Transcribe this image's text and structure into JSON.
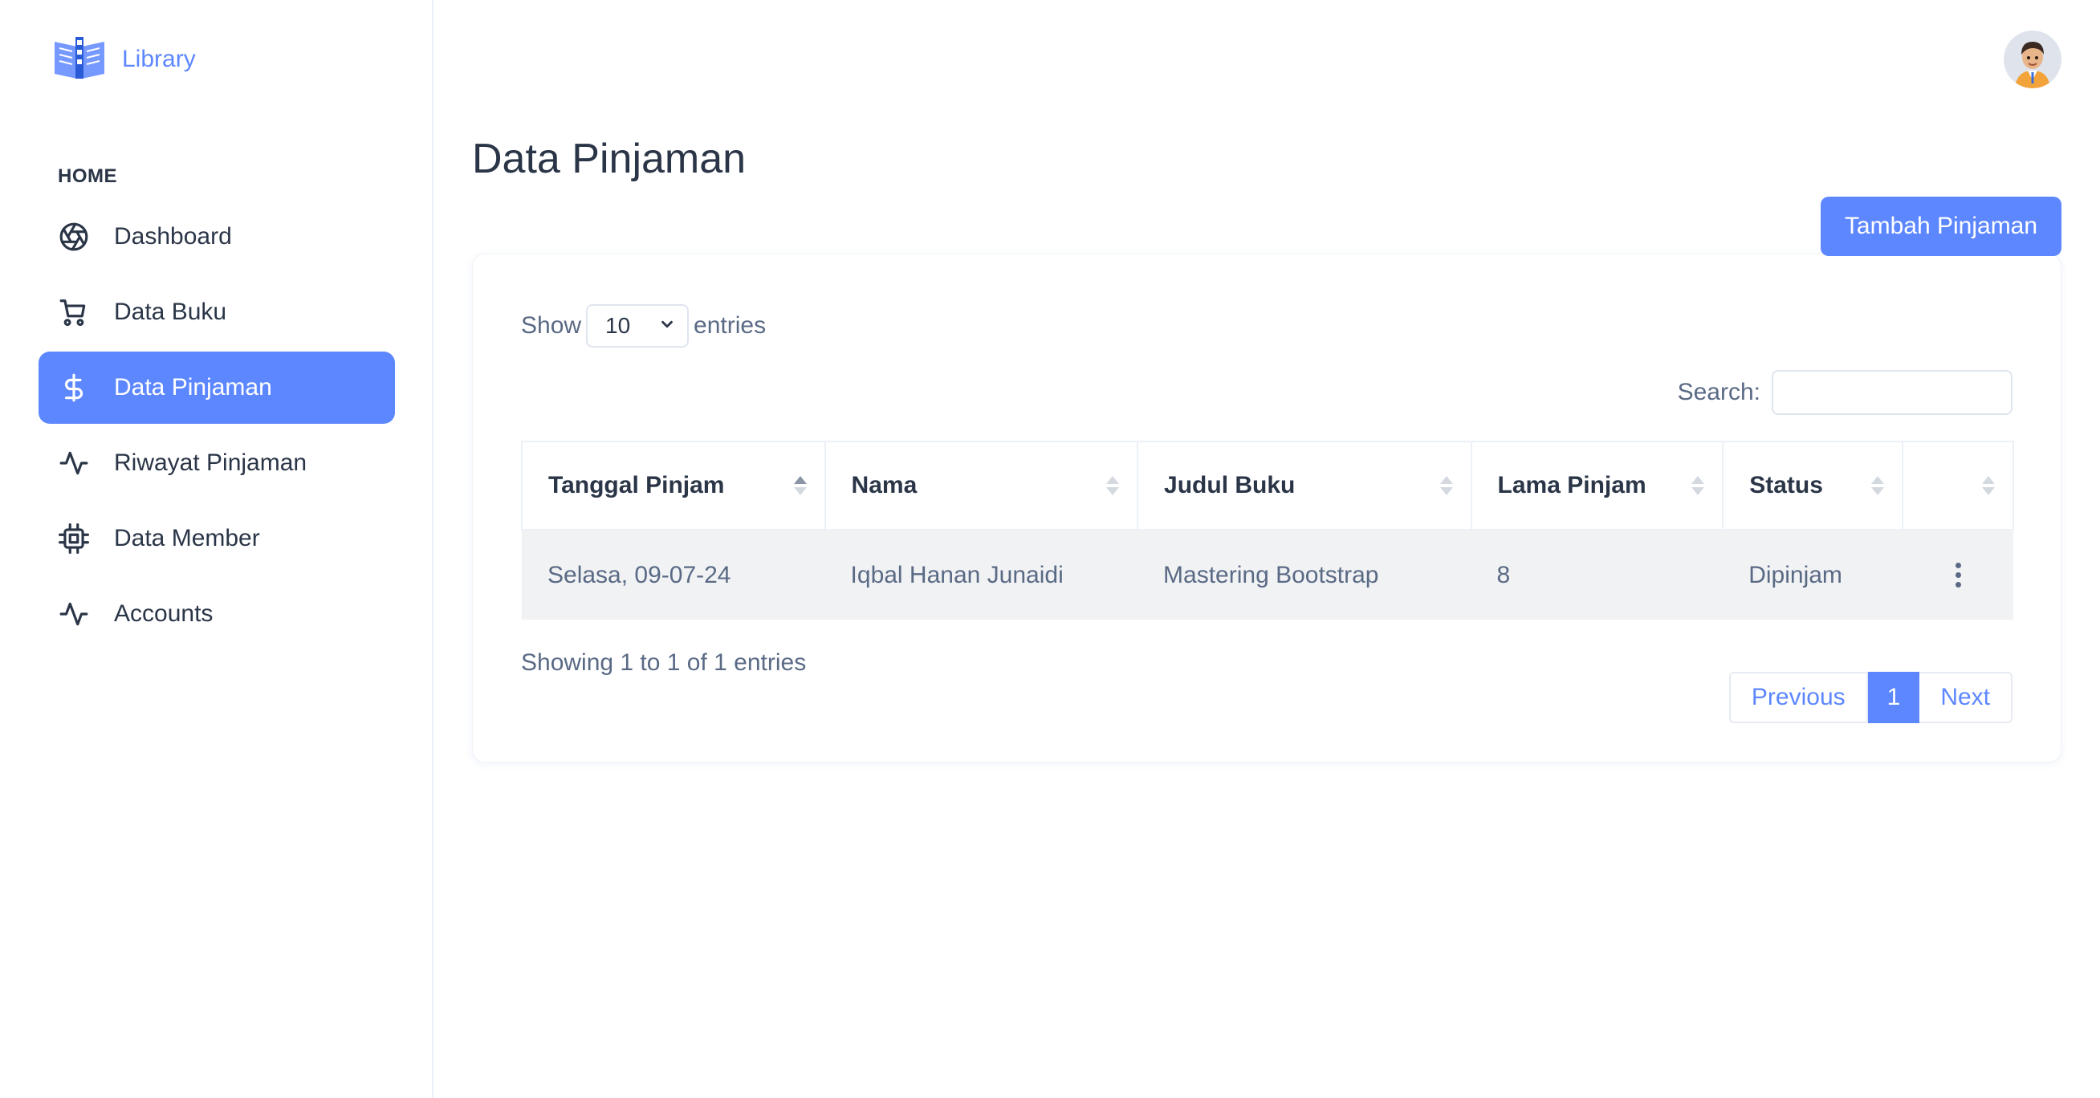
{
  "brand": {
    "name": "Library",
    "icon": "library-book-icon"
  },
  "sidebar": {
    "heading": "HOME",
    "items": [
      {
        "label": "Dashboard",
        "icon": "aperture-icon",
        "active": false
      },
      {
        "label": "Data Buku",
        "icon": "cart-icon",
        "active": false
      },
      {
        "label": "Data Pinjaman",
        "icon": "dollar-icon",
        "active": true
      },
      {
        "label": "Riwayat Pinjaman",
        "icon": "activity-icon",
        "active": false
      },
      {
        "label": "Data Member",
        "icon": "cpu-icon",
        "active": false
      },
      {
        "label": "Accounts",
        "icon": "activity-icon",
        "active": false
      }
    ]
  },
  "page": {
    "title": "Data Pinjaman",
    "add_button": "Tambah Pinjaman"
  },
  "table_controls": {
    "show_label": "Show",
    "entries_value": "10",
    "entries_label": "entries",
    "search_label": "Search:",
    "search_value": "",
    "search_placeholder": ""
  },
  "table": {
    "columns": [
      "Tanggal Pinjam",
      "Nama",
      "Judul Buku",
      "Lama Pinjam",
      "Status",
      ""
    ],
    "rows": [
      [
        "Selasa, 09-07-24",
        "Iqbal Hanan Junaidi",
        "Mastering Bootstrap",
        "8",
        "Dipinjam"
      ]
    ]
  },
  "footer": {
    "info": "Showing 1 to 1 of 1 entries",
    "prev": "Previous",
    "current_page": "1",
    "next": "Next"
  },
  "colors": {
    "accent": "#5d87ff",
    "text": "#2a3547",
    "muted": "#5a6a85"
  }
}
